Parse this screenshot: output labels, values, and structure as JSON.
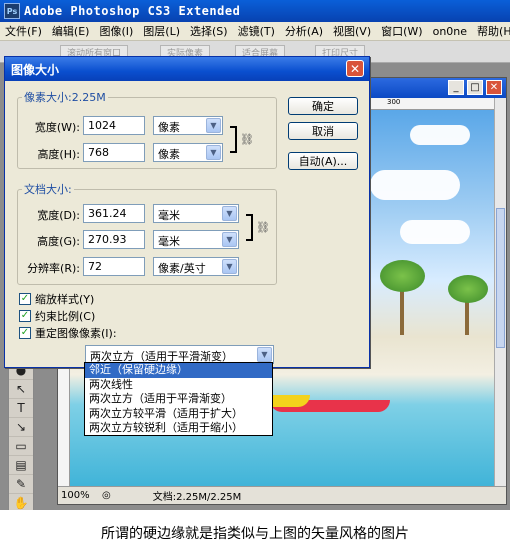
{
  "app": {
    "title": "Adobe Photoshop CS3 Extended",
    "icon_text": "Ps"
  },
  "menubar": [
    "文件(F)",
    "编辑(E)",
    "图像(I)",
    "图层(L)",
    "选择(S)",
    "滤镜(T)",
    "分析(A)",
    "视图(V)",
    "窗口(W)",
    "on0ne",
    "帮助(H)"
  ],
  "optbar": [
    "滚动所有窗口",
    "实际像素",
    "适合屏幕",
    "打印尺寸"
  ],
  "document": {
    "ruler_mark": "300",
    "zoom": "100%",
    "doc_size": "文档:2.25M/2.25M"
  },
  "dialog": {
    "title": "图像大小",
    "pixel_dims": {
      "legend": "像素大小:2.25M",
      "width_label": "宽度(W):",
      "width_value": "1024",
      "width_unit": "像素",
      "height_label": "高度(H):",
      "height_value": "768",
      "height_unit": "像素"
    },
    "doc_size": {
      "legend": "文档大小:",
      "width_label": "宽度(D):",
      "width_value": "361.24",
      "width_unit": "毫米",
      "height_label": "高度(G):",
      "height_value": "270.93",
      "height_unit": "毫米",
      "res_label": "分辨率(R):",
      "res_value": "72",
      "res_unit": "像素/英寸"
    },
    "buttons": {
      "ok": "确定",
      "cancel": "取消",
      "auto": "自动(A)..."
    },
    "checks": {
      "scale_styles": "缩放样式(Y)",
      "constrain": "约束比例(C)",
      "resample": "重定图像像素(I):"
    },
    "resample_selected": "两次立方（适用于平滑渐变）",
    "resample_options": [
      "邻近（保留硬边缘）",
      "两次线性",
      "两次立方（适用于平滑渐变）",
      "两次立方较平滑（适用于扩大）",
      "两次立方较锐利（适用于缩小）"
    ],
    "highlighted_index": 0
  },
  "caption": "所谓的硬边缘就是指类似与上图的矢量风格的图片"
}
